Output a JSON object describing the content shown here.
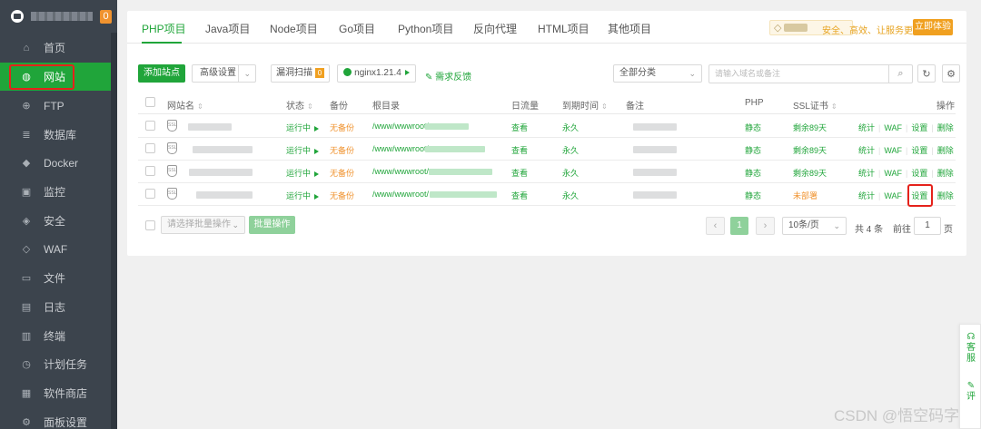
{
  "sidebar": {
    "badge": "0",
    "items": [
      {
        "label": "首页",
        "icon": "home-icon",
        "glyph": "⌂"
      },
      {
        "label": "网站",
        "icon": "globe-icon",
        "glyph": "◍"
      },
      {
        "label": "FTP",
        "icon": "ftp-icon",
        "glyph": "⊕"
      },
      {
        "label": "数据库",
        "icon": "database-icon",
        "glyph": "≣"
      },
      {
        "label": "Docker",
        "icon": "docker-icon",
        "glyph": "◆"
      },
      {
        "label": "监控",
        "icon": "monitor-icon",
        "glyph": "▣"
      },
      {
        "label": "安全",
        "icon": "shield-icon",
        "glyph": "◈"
      },
      {
        "label": "WAF",
        "icon": "waf-icon",
        "glyph": "◇"
      },
      {
        "label": "文件",
        "icon": "folder-icon",
        "glyph": "▭"
      },
      {
        "label": "日志",
        "icon": "log-icon",
        "glyph": "▤"
      },
      {
        "label": "终端",
        "icon": "terminal-icon",
        "glyph": "▥"
      },
      {
        "label": "计划任务",
        "icon": "clock-icon",
        "glyph": "◷"
      },
      {
        "label": "软件商店",
        "icon": "store-icon",
        "glyph": "▦"
      },
      {
        "label": "面板设置",
        "icon": "settings-icon",
        "glyph": "⚙"
      }
    ]
  },
  "tabs": [
    "PHP项目",
    "Java项目",
    "Node项目",
    "Go项目",
    "Python项目",
    "反向代理",
    "HTML项目",
    "其他项目"
  ],
  "enterprise": {
    "text": "安全、高效、让服务更安心",
    "try_label": "立即体验"
  },
  "toolbar": {
    "add_site": "添加站点",
    "advanced": "高级设置",
    "vuln_scan": "漏洞扫描",
    "vuln_count": "0",
    "nginx": "nginx1.21.4",
    "feedback": "需求反馈",
    "category": "全部分类",
    "search_placeholder": "请输入域名或备注"
  },
  "table": {
    "headers": {
      "name": "网站名",
      "status": "状态",
      "backup": "备份",
      "root": "根目录",
      "traffic": "日流量",
      "expire": "到期时间",
      "note": "备注",
      "php": "PHP",
      "ssl": "SSL证书",
      "ops": "操作"
    },
    "rows": [
      {
        "status": "运行中",
        "backup": "无备份",
        "root": "/www/wwwroot/",
        "traffic": "查看",
        "expire": "永久",
        "php": "静态",
        "ssl": "剩余89天",
        "ops": [
          "统计",
          "WAF",
          "设置",
          "删除"
        ]
      },
      {
        "status": "运行中",
        "backup": "无备份",
        "root": "/www/wwwroot/",
        "traffic": "查看",
        "expire": "永久",
        "php": "静态",
        "ssl": "剩余89天",
        "ops": [
          "统计",
          "WAF",
          "设置",
          "删除"
        ]
      },
      {
        "status": "运行中",
        "backup": "无备份",
        "root": "/www/wwwroot/",
        "traffic": "查看",
        "expire": "永久",
        "php": "静态",
        "ssl": "剩余89天",
        "ops": [
          "统计",
          "WAF",
          "设置",
          "删除"
        ]
      },
      {
        "status": "运行中",
        "backup": "无备份",
        "root": "/www/wwwroot/",
        "traffic": "查看",
        "expire": "永久",
        "php": "静态",
        "ssl": "未部署",
        "ops": [
          "统计",
          "WAF",
          "设置",
          "删除"
        ]
      }
    ]
  },
  "footer": {
    "batch_select": "请选择批量操作",
    "batch_btn": "批量操作",
    "current_page": "1",
    "per_page": "10条/页",
    "total": "共 4 条",
    "goto": "前往",
    "page_input": "1",
    "page_unit": "页"
  },
  "float": {
    "service": "客服",
    "review": "评"
  },
  "watermark": "CSDN @悟空码字"
}
